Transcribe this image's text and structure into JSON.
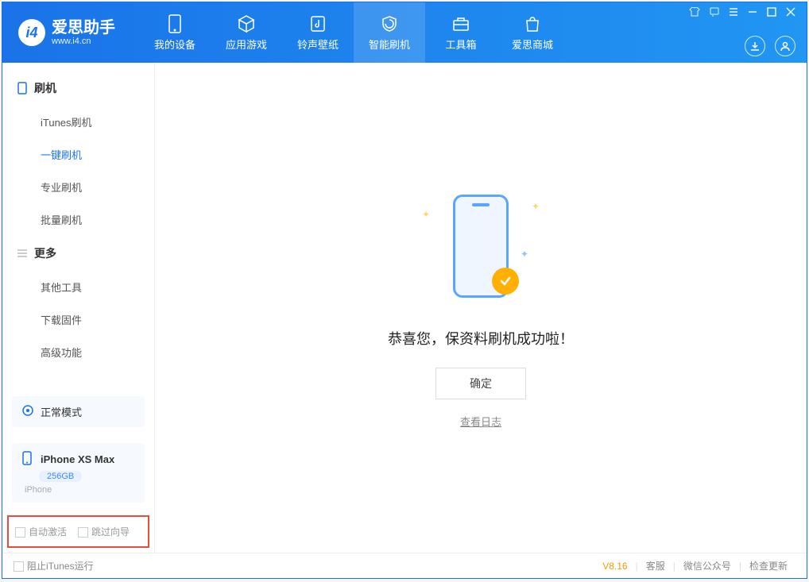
{
  "app": {
    "title": "爱思助手",
    "subtitle": "www.i4.cn"
  },
  "tabs": [
    {
      "label": "我的设备"
    },
    {
      "label": "应用游戏"
    },
    {
      "label": "铃声壁纸"
    },
    {
      "label": "智能刷机"
    },
    {
      "label": "工具箱"
    },
    {
      "label": "爱思商城"
    }
  ],
  "sidebar": {
    "group1": {
      "title": "刷机"
    },
    "items1": [
      {
        "label": "iTunes刷机"
      },
      {
        "label": "一键刷机"
      },
      {
        "label": "专业刷机"
      },
      {
        "label": "批量刷机"
      }
    ],
    "group2": {
      "title": "更多"
    },
    "items2": [
      {
        "label": "其他工具"
      },
      {
        "label": "下载固件"
      },
      {
        "label": "高级功能"
      }
    ],
    "mode": "正常模式",
    "device": {
      "name": "iPhone XS Max",
      "capacity": "256GB",
      "type": "iPhone"
    },
    "checkbox1": "自动激活",
    "checkbox2": "跳过向导"
  },
  "main": {
    "success_text": "恭喜您，保资料刷机成功啦！",
    "ok_button": "确定",
    "log_link": "查看日志"
  },
  "footer": {
    "stop_itunes": "阻止iTunes运行",
    "version": "V8.16",
    "link1": "客服",
    "link2": "微信公众号",
    "link3": "检查更新"
  }
}
